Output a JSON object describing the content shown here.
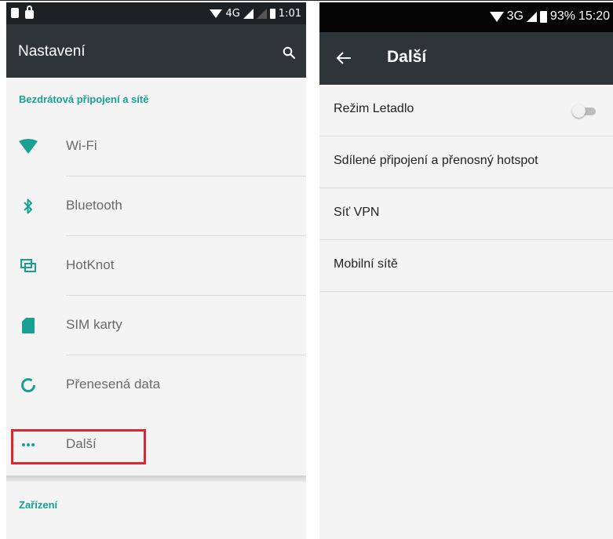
{
  "left_screen": {
    "status_bar": {
      "network": "4G",
      "time": "1:01"
    },
    "app_bar": {
      "title": "Nastavení",
      "search_icon": "search-icon"
    },
    "section_wireless": "Bezdrátová připojení a sítě",
    "items": [
      {
        "label": "Wi-Fi",
        "icon": "wifi-icon"
      },
      {
        "label": "Bluetooth",
        "icon": "bluetooth-icon"
      },
      {
        "label": "HotKnot",
        "icon": "hotknot-icon"
      },
      {
        "label": "SIM karty",
        "icon": "sim-card-icon"
      },
      {
        "label": "Přenesená data",
        "icon": "data-usage-icon"
      },
      {
        "label": "Další",
        "icon": "more-icon"
      }
    ],
    "section_device": "Zařízení",
    "accent_color": "#18a095",
    "highlight_color": "#e0252e"
  },
  "right_screen": {
    "status_bar": {
      "network": "3G",
      "battery": "93%",
      "time": "15:20"
    },
    "app_bar": {
      "title": "Další",
      "back_icon": "arrow-back-icon"
    },
    "items": [
      {
        "label": "Režim Letadlo",
        "toggle": false
      },
      {
        "label": "Sdílené připojení a přenosný hotspot"
      },
      {
        "label": "Síť VPN"
      },
      {
        "label": "Mobilní sítě"
      }
    ]
  }
}
